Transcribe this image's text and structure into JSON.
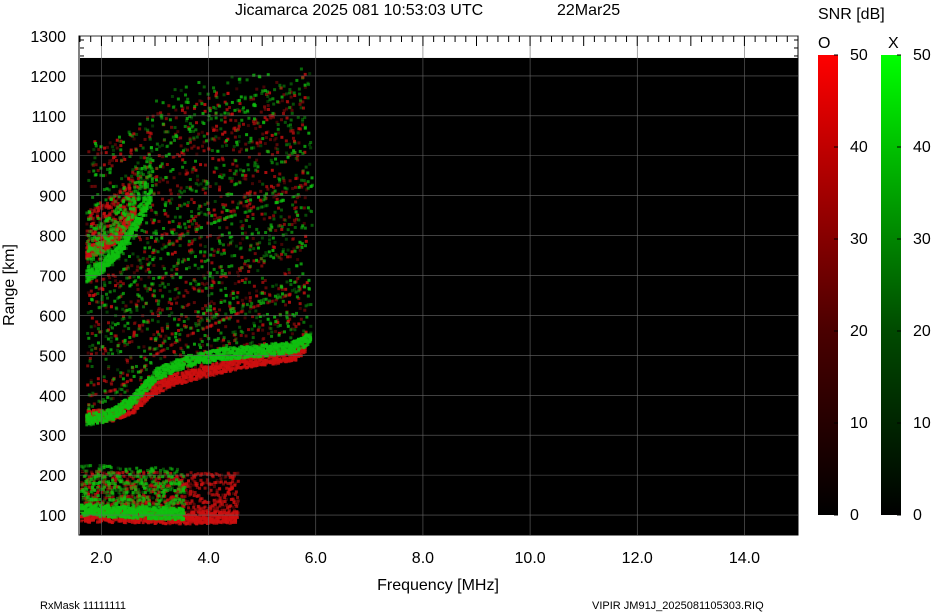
{
  "chart_data": {
    "type": "heatmap",
    "title": "Jicamarca 2025 081 10:53:03 UTC",
    "date": "22Mar25",
    "xlabel": "Frequency [MHz]",
    "ylabel": "Range [km]",
    "xlim": [
      1.6,
      15.0
    ],
    "ylim": [
      50,
      1300
    ],
    "x_ticks": [
      2.0,
      4.0,
      6.0,
      8.0,
      10.0,
      12.0,
      14.0
    ],
    "x_tick_labels": [
      "2.0",
      "4.0",
      "6.0",
      "8.0",
      "10.0",
      "12.0",
      "14.0"
    ],
    "y_ticks": [
      100,
      200,
      300,
      400,
      500,
      600,
      700,
      800,
      900,
      1000,
      1100,
      1200,
      1300
    ],
    "y_tick_labels": [
      "100",
      "200",
      "300",
      "400",
      "500",
      "600",
      "700",
      "800",
      "900",
      "1000",
      "1100",
      "1200",
      "1300"
    ],
    "data_max_range_km": 1245,
    "grid": true,
    "colorbar": {
      "title": "SNR [dB]",
      "range": [
        0,
        50
      ],
      "ticks": [
        0,
        10,
        20,
        30,
        40,
        50
      ],
      "tick_labels": [
        "0",
        "10",
        "20",
        "30",
        "40",
        "50"
      ],
      "o_label": "O",
      "x_label": "X",
      "o_color": "#ff0000",
      "x_color": "#00ff00"
    },
    "series": [
      {
        "name": "O",
        "color": "#cc1010",
        "traces": [
          {
            "f": [
              1.7,
              2.2,
              2.6,
              2.9,
              3.4,
              4.0,
              4.6,
              5.2,
              5.6,
              5.8
            ],
            "h": [
              345,
              348,
              370,
              410,
              440,
              460,
              480,
              490,
              500,
              520
            ]
          },
          {
            "f": [
              1.7,
              2.0,
              2.3,
              2.6
            ],
            "h": [
              755,
              770,
              800,
              860
            ]
          },
          {
            "f": [
              1.6,
              2.5,
              3.5,
              4.5
            ],
            "h": [
              95,
              93,
              90,
              92
            ]
          }
        ]
      },
      {
        "name": "X",
        "color": "#10c010",
        "traces": [
          {
            "f": [
              1.7,
              2.2,
              2.6,
              3.0,
              3.5,
              4.2,
              5.0,
              5.6,
              5.9
            ],
            "h": [
              335,
              350,
              390,
              450,
              480,
              500,
              510,
              520,
              540
            ]
          },
          {
            "f": [
              1.7,
              2.0,
              2.3,
              2.6,
              2.9
            ],
            "h": [
              695,
              720,
              760,
              820,
              900
            ]
          },
          {
            "f": [
              1.6,
              2.5,
              3.5
            ],
            "h": [
              110,
              105,
              100
            ]
          }
        ]
      }
    ]
  },
  "footer": {
    "left": "RxMask 11111111",
    "right": "VIPIR  JM91J_2025081105303.RIQ"
  }
}
